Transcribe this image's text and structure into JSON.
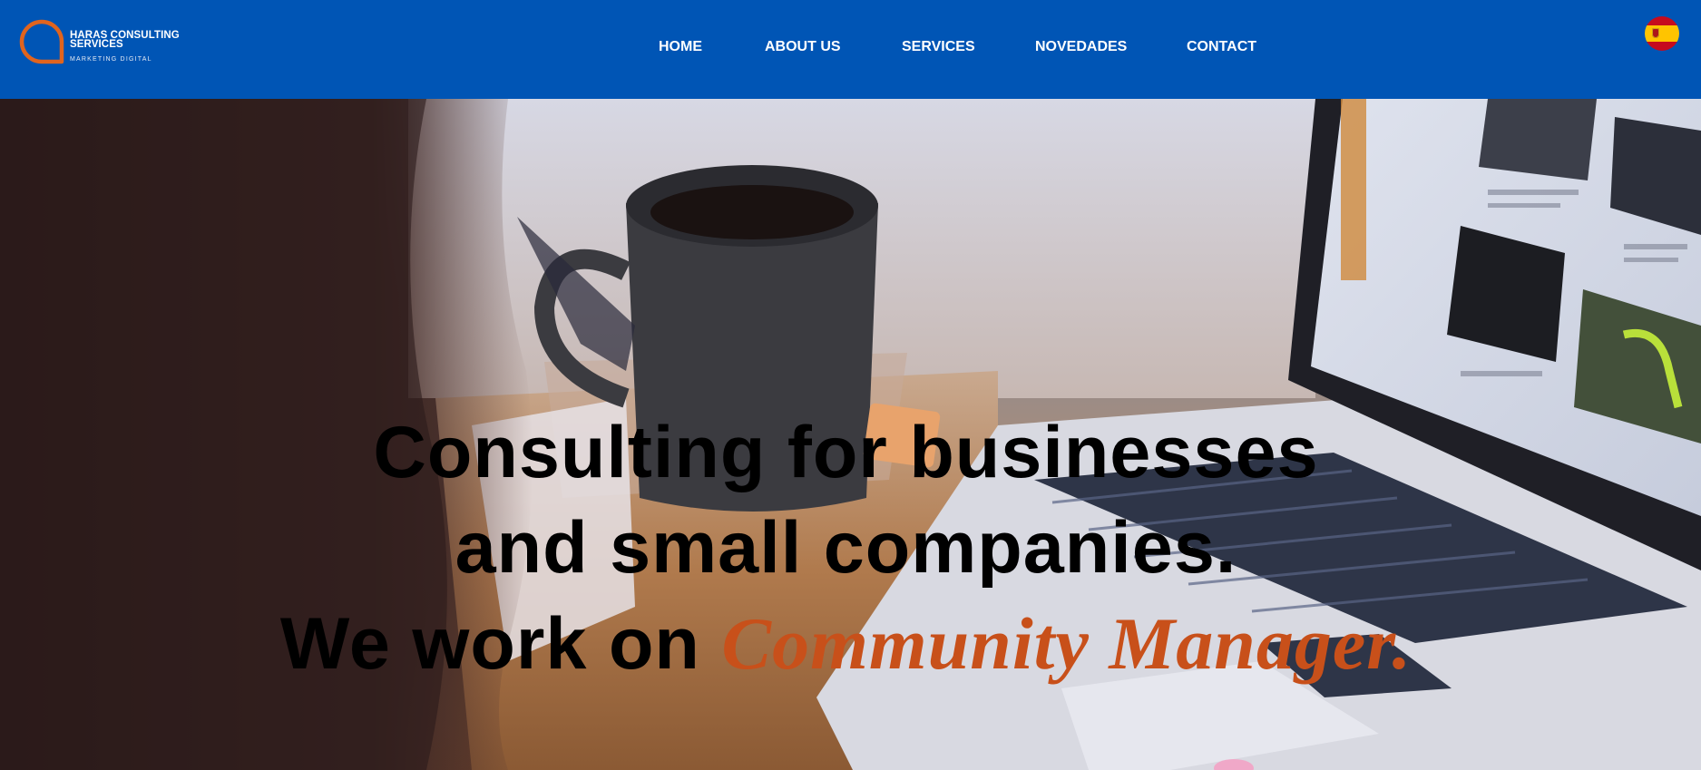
{
  "brand": {
    "name_line1": "HARAS CONSULTING",
    "name_line2": "SERVICES",
    "tagline": "MARKETING DIGITAL",
    "accent_color": "#e0641e",
    "nav_bg_color": "#0055b5"
  },
  "nav": {
    "items": [
      {
        "label": "HOME"
      },
      {
        "label": "ABOUT US"
      },
      {
        "label": "SERVICES"
      },
      {
        "label": "NOVEDADES"
      },
      {
        "label": "CONTACT"
      }
    ],
    "language_icon": "spain-flag-icon"
  },
  "hero": {
    "line1": "Consulting for businesses",
    "line2": "and small companies.",
    "line3_prefix": "We work on ",
    "line3_highlight": "Community Manager.",
    "highlight_color": "#c8501a",
    "background": "photo: woman at desk with coffee mug and laptop"
  }
}
